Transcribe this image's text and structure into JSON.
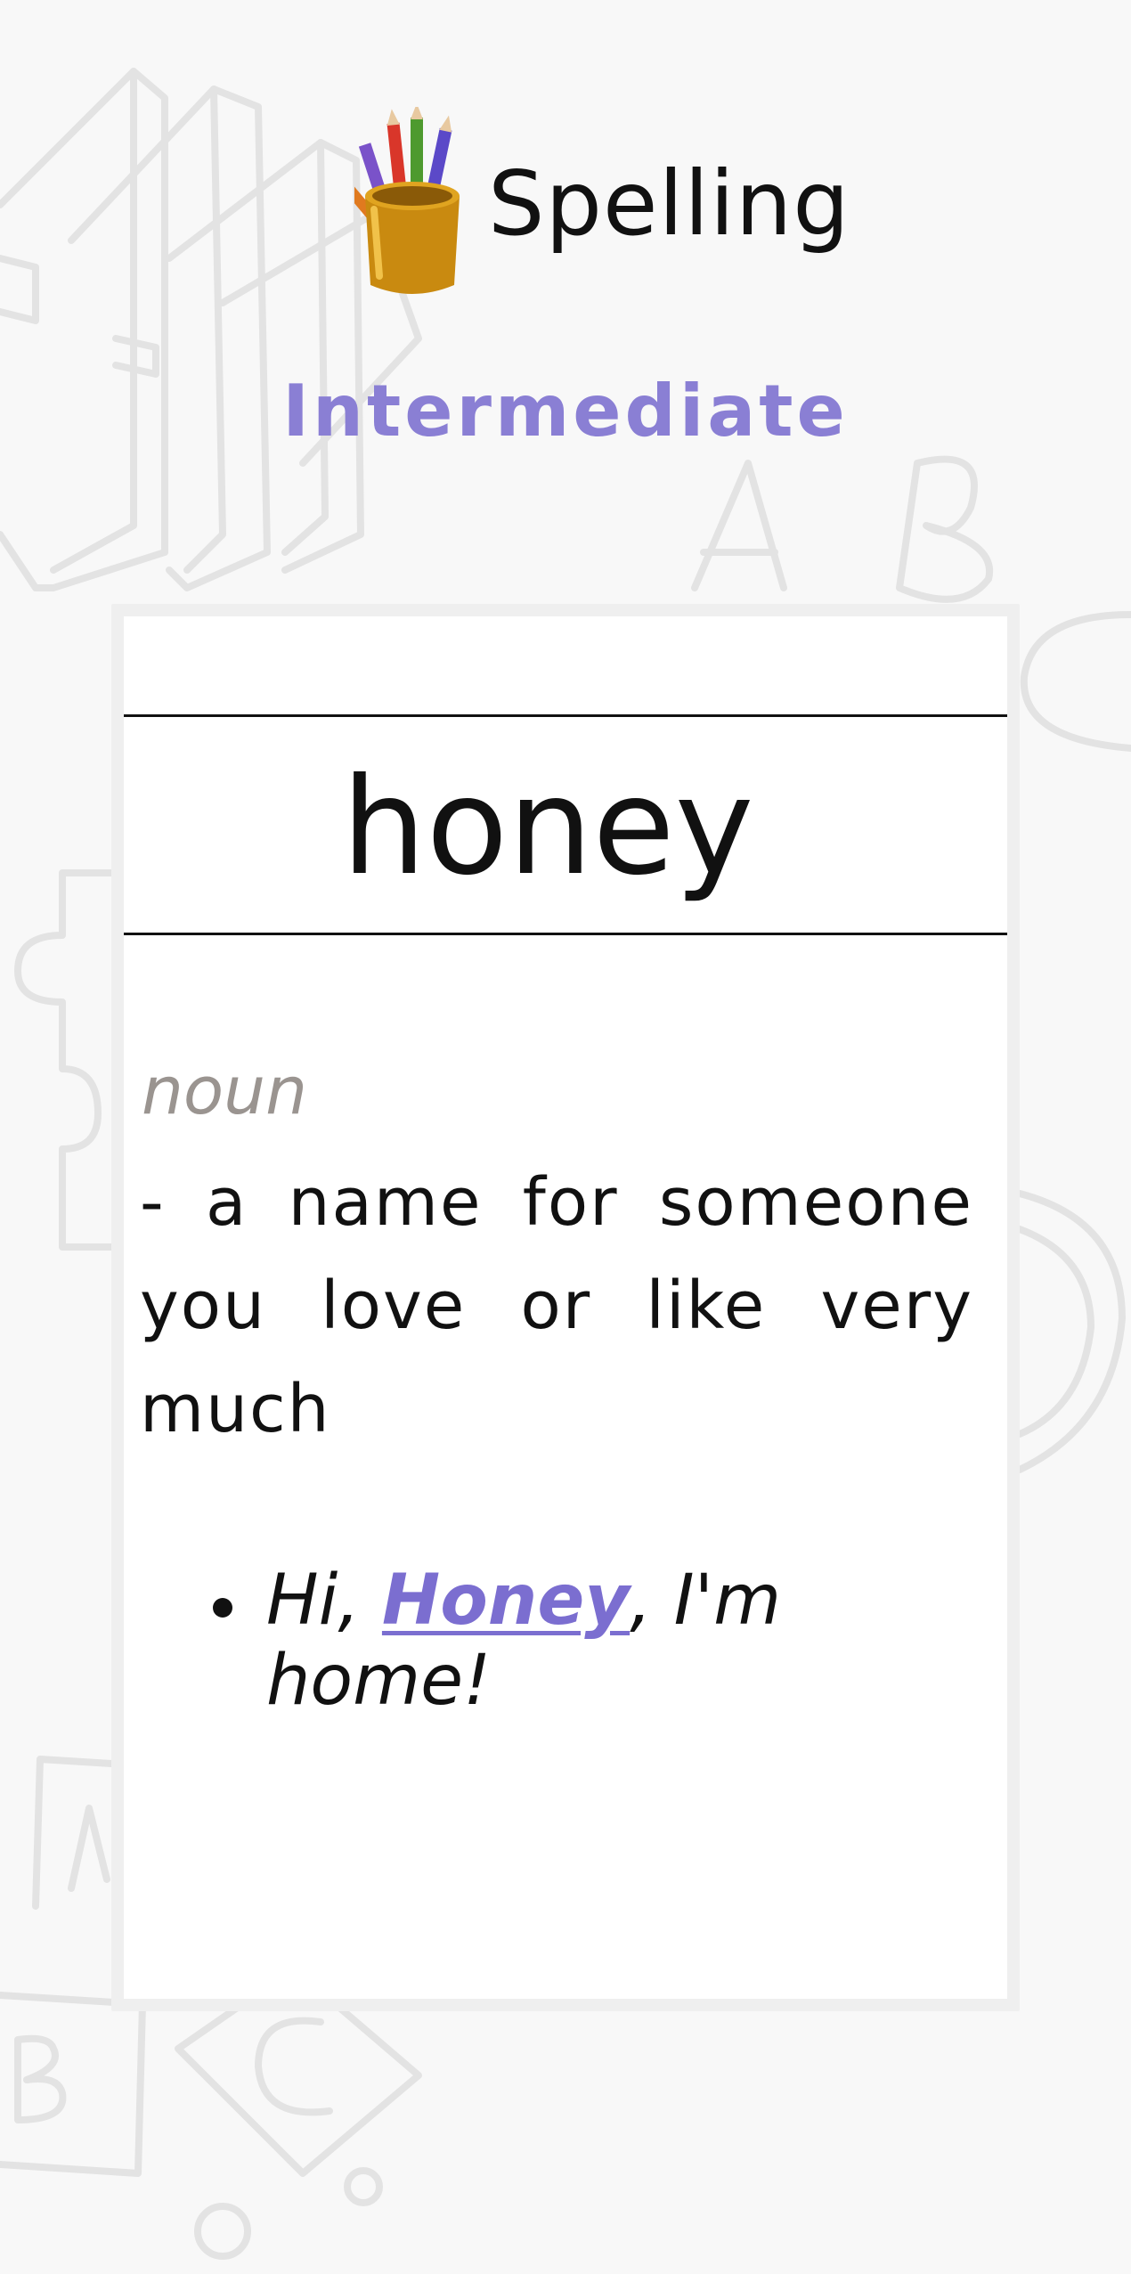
{
  "header": {
    "title": "Spelling",
    "icon": "pencil-cup-icon"
  },
  "level": "Intermediate",
  "card": {
    "word": "honey",
    "part_of_speech": "noun",
    "definition": " - a name for someone you love or like very much",
    "example": {
      "prefix": "Hi, ",
      "highlight": "Honey",
      "suffix": ", I'm home!"
    }
  },
  "colors": {
    "accent": "#8a7fd4",
    "highlight": "#7b6ed0",
    "background": "#f8f8f8",
    "card": "#ffffff",
    "pos": "#9a9490"
  }
}
